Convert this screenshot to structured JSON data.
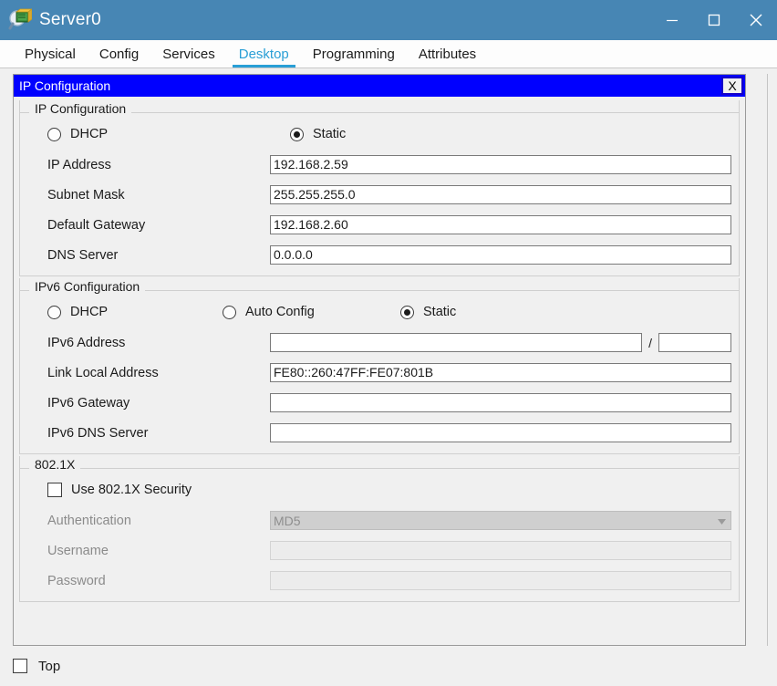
{
  "window": {
    "title": "Server0",
    "icon": "packet-tracer-device-icon",
    "minimize_label": "–",
    "maximize_label": "□",
    "close_label": "✕"
  },
  "tabs": [
    {
      "label": "Physical",
      "active": false
    },
    {
      "label": "Config",
      "active": false
    },
    {
      "label": "Services",
      "active": false
    },
    {
      "label": "Desktop",
      "active": true
    },
    {
      "label": "Programming",
      "active": false
    },
    {
      "label": "Attributes",
      "active": false
    }
  ],
  "inner_window": {
    "title": "IP Configuration",
    "close_label": "X"
  },
  "ip_configuration": {
    "group_label": "IP Configuration",
    "dhcp_label": "DHCP",
    "dhcp_selected": false,
    "static_label": "Static",
    "static_selected": true,
    "fields": [
      {
        "label": "IP Address",
        "value": "192.168.2.59"
      },
      {
        "label": "Subnet Mask",
        "value": "255.255.255.0"
      },
      {
        "label": "Default Gateway",
        "value": "192.168.2.60"
      },
      {
        "label": "DNS Server",
        "value": "0.0.0.0"
      }
    ]
  },
  "ipv6_configuration": {
    "group_label": "IPv6 Configuration",
    "dhcp_label": "DHCP",
    "dhcp_selected": false,
    "auto_config_label": "Auto Config",
    "auto_config_selected": false,
    "static_label": "Static",
    "static_selected": true,
    "address_label": "IPv6 Address",
    "address_value": "",
    "prefix_separator": "/",
    "prefix_value": "",
    "link_local_label": "Link Local Address",
    "link_local_value": "FE80::260:47FF:FE07:801B",
    "gateway_label": "IPv6 Gateway",
    "gateway_value": "",
    "dns_label": "IPv6 DNS Server",
    "dns_value": ""
  },
  "dot1x": {
    "group_label": "802.1X",
    "use_security_label": "Use 802.1X Security",
    "use_security_checked": false,
    "authentication_label": "Authentication",
    "authentication_value": "MD5",
    "username_label": "Username",
    "username_value": "",
    "password_label": "Password",
    "password_value": ""
  },
  "bottom": {
    "top_label": "Top",
    "top_checked": false
  },
  "colors": {
    "titlebar": "#4786b4",
    "inner_titlebar": "#0000ff",
    "accent_tab": "#2a9fd6",
    "panel": "#f0f0f0"
  }
}
